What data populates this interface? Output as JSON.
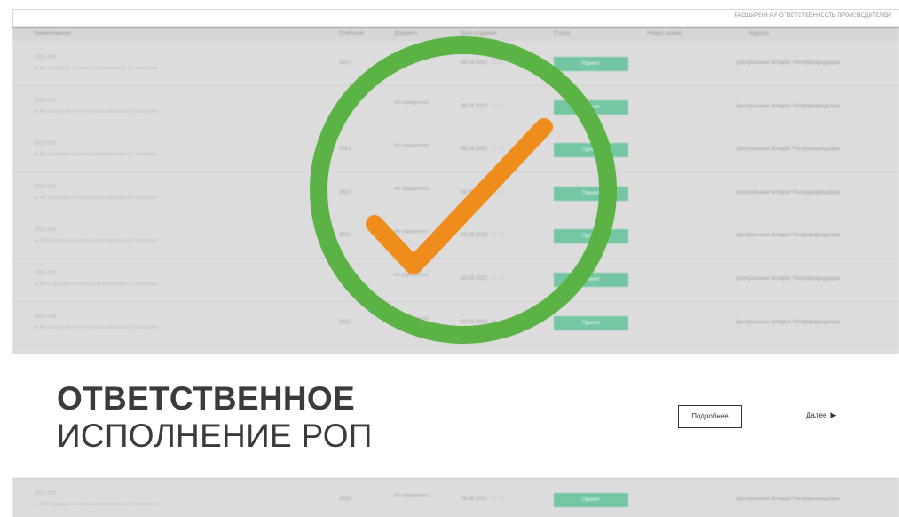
{
  "header": {
    "caption": "Расширенная ответственность производителей"
  },
  "table": {
    "columns": [
      "Наименование",
      "Отчётный",
      "Документ",
      "Дата создания",
      "Статус",
      "Номер заявки",
      "Адресат"
    ],
    "rows": [
      {
        "number": "2022 000",
        "desc": "№ АФ-1 сведения по отчёту ответственности в 2 категориях",
        "year": "2021",
        "state": "Не определено",
        "date": "09.03.2022",
        "time": "13:00",
        "status": "Принят",
        "org": "Центральный аппарат Росприроднадзора"
      },
      {
        "number": "2022 001",
        "desc": "№ АФ-1 сведения по отчёту ответственности в 2 категориях",
        "year": "",
        "state": "Не определено",
        "date": "06.03.2022",
        "time": "13:00",
        "status": "Принят",
        "org": "Центральный аппарат Росприроднадзора"
      },
      {
        "number": "2022 002",
        "desc": "№ АФ-1 сведения по отчёту ответственности в 2 категориях",
        "year": "2021",
        "state": "Не определено",
        "date": "06.03.2022",
        "time": "13:00",
        "status": "Принят",
        "org": "Центральный аппарат Росприроднадзора"
      },
      {
        "number": "2022 003",
        "desc": "№ АФ-1 сведения по отчёту ответственности в 2 категориях",
        "year": "2021",
        "state": "Не определено",
        "date": "03.03.2022",
        "time": "13:00",
        "status": "Принят",
        "org": "Центральный аппарат Росприроднадзора"
      },
      {
        "number": "2022 004",
        "desc": "№ АФ-1 сведения по отчёту ответственности в 2 категориях",
        "year": "2021",
        "state": "Не определено",
        "date": "03.03.2022",
        "time": "13:00",
        "status": "Принят",
        "org": "Центральный аппарат Росприроднадзора"
      },
      {
        "number": "2022 005",
        "desc": "№ АФ-1 сведения по отчёту ответственности в 2 категориях",
        "year": "",
        "state": "Не определено",
        "date": "03.03.2022",
        "time": "13:00",
        "status": "Принят",
        "org": "Центральный аппарат Росприроднадзора"
      },
      {
        "number": "2022 006",
        "desc": "№ АФ-1 сведения по отчёту ответственности в 2 категориях",
        "year": "2021",
        "state": "Не определено",
        "date": "02.03.2022",
        "time": "13:00",
        "status": "Принят",
        "org": "Центральный аппарат Росприроднадзора"
      }
    ],
    "bottom_row": {
      "number": "2021 010",
      "desc": "№ АФ-1 сведения по отчёту ответственности в 2 категориях",
      "year": "2020",
      "state": "Не определено",
      "date": "25.08.2021",
      "time": "13:00",
      "status": "Принят",
      "org": "Центральный аппарат Росприроднадзора"
    }
  },
  "banner": {
    "title_line1": "ОТВЕТСТВЕННОЕ",
    "title_line2": "ИСПОЛНЕНИЕ РОП",
    "more_button": "Подробнее",
    "next_link": "Далее",
    "next_arrow": "▶"
  },
  "overlay": {
    "icon": "checkmark-circle-icon",
    "circle_color": "#5bb346",
    "check_color": "#ef8d1c"
  },
  "colors": {
    "status_button": "#74c7a2",
    "table_background": "#dcdcdc",
    "title_text": "#3b3b3b"
  }
}
